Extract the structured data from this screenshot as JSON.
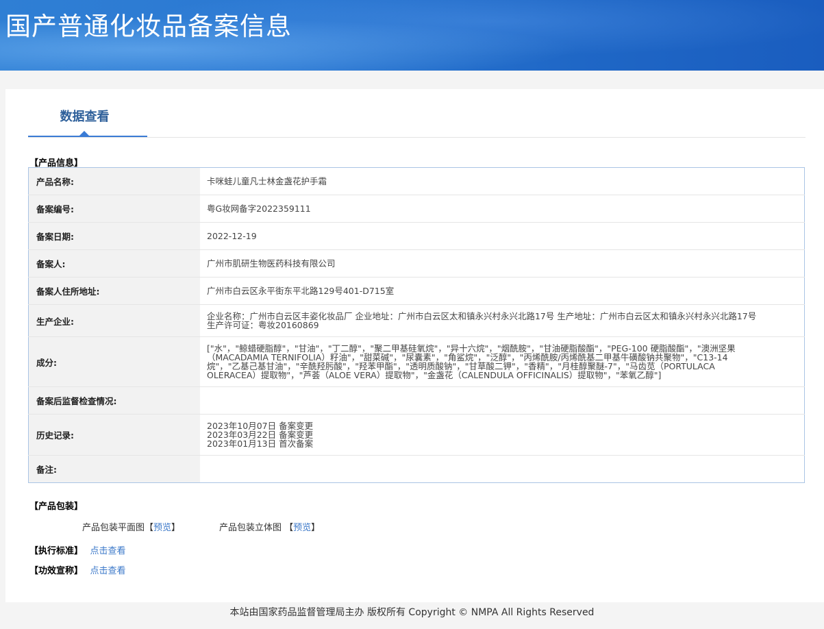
{
  "header": {
    "title": "国产普通化妆品备案信息"
  },
  "tabs": [
    {
      "label": "数据查看"
    }
  ],
  "sections": {
    "product_info": "【产品信息】",
    "packaging": "【产品包装】",
    "standard": "【执行标准】",
    "efficacy": "【功效宣称】"
  },
  "product_info": {
    "rows": [
      {
        "label": "产品名称:",
        "value": "卡咪蛙儿童凡士林金盏花护手霜"
      },
      {
        "label": "备案编号:",
        "value": "粤G妆网备字2022359111"
      },
      {
        "label": "备案日期:",
        "value": "2022-12-19"
      },
      {
        "label": "备案人:",
        "value": "广州市肌研生物医药科技有限公司"
      },
      {
        "label": "备案人住所地址:",
        "value": "广州市白云区永平街东平北路129号401-D715室"
      },
      {
        "label": "生产企业:",
        "value": "企业名称：广州市白云区丰姿化妆品厂 企业地址：广州市白云区太和镇永兴村永兴北路17号 生产地址：广州市白云区太和镇永兴村永兴北路17号 生产许可证：粤妆20160869"
      },
      {
        "label": "成分:",
        "value": "[\"水\"，\"鲸蜡硬脂醇\"，\"甘油\"，\"丁二醇\"，\"聚二甲基硅氧烷\"，\"异十六烷\"，\"烟酰胺\"，\"甘油硬脂酸酯\"，\"PEG-100 硬脂酸酯\"，\"澳洲坚果（MACADAMIA TERNIFOLIA）籽油\"，\"甜菜碱\"，\"尿囊素\"，\"角鲨烷\"，\"泛醇\"，\"丙烯酰胺/丙烯酰基二甲基牛磺酸钠共聚物\"，\"C13-14 烷\"，\"乙基己基甘油\"，\"辛酰羟肟酸\"，\"羟苯甲酯\"，\"透明质酸钠\"，\"甘草酸二钾\"，\"香精\"，\"月桂醇聚醚-7\"，\"马齿苋（PORTULACA OLERACEA）提取物\"，\"芦荟（ALOE VERA）提取物\"，\"金盏花（CALENDULA OFFICINALIS）提取物\"，\"苯氧乙醇\"]"
      },
      {
        "label": "备案后监督检查情况:",
        "value": ""
      },
      {
        "label": "历史记录:",
        "value": "",
        "history": [
          "2023年10月07日 备案变更",
          "2023年03月22日 备案变更",
          "2023年01月13日 首次备案"
        ]
      },
      {
        "label": "备注:",
        "value": ""
      }
    ]
  },
  "packaging": {
    "flat_label": "产品包装平面图",
    "flat_preview": "预览",
    "three_d_label": "产品包装立体图",
    "three_d_preview": "预览"
  },
  "standard_link": "点击查看",
  "efficacy_link": "点击查看",
  "footer": {
    "text": "本站由国家药品监督管理局主办 版权所有 Copyright © NMPA All Rights Reserved"
  }
}
